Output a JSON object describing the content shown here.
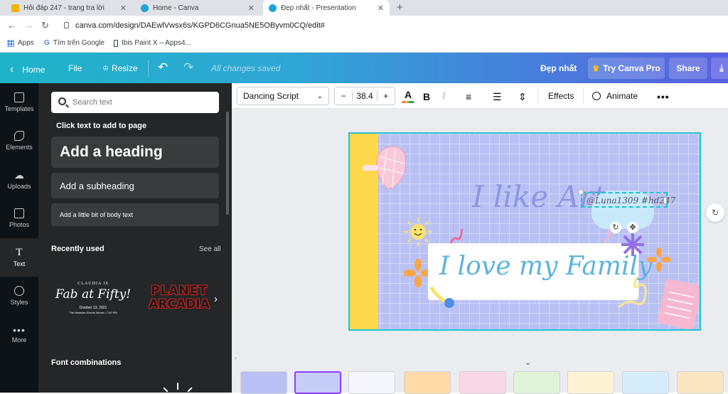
{
  "browser": {
    "tabs": [
      {
        "title": "Hỏi đáp 247 - trang tra lời",
        "active": false
      },
      {
        "title": "Home - Canva",
        "active": false
      },
      {
        "title": "Đẹp nhất - Presentation",
        "active": true
      }
    ],
    "url": "canva.com/design/DAEwlVwsx6s/KGPD6CGnua5NE5OByvm0CQ/edit#",
    "bookmarks": [
      "Apps",
      "Tìm trên Google",
      "Ibis Paint X – Apps4..."
    ]
  },
  "header": {
    "home": "Home",
    "file": "File",
    "resize": "Resize",
    "save_status": "All changes saved",
    "doc_title": "Đẹp nhất",
    "try_pro": "Try Canva Pro",
    "share": "Share"
  },
  "rail": [
    {
      "label": "Templates",
      "icon": "templates-icon"
    },
    {
      "label": "Elements",
      "icon": "elements-icon"
    },
    {
      "label": "Uploads",
      "icon": "uploads-icon"
    },
    {
      "label": "Photos",
      "icon": "photos-icon"
    },
    {
      "label": "Text",
      "icon": "text-icon",
      "active": true
    },
    {
      "label": "Styles",
      "icon": "styles-icon"
    },
    {
      "label": "More",
      "icon": "more-icon"
    }
  ],
  "panel": {
    "search_placeholder": "Search text",
    "click_hint": "Click text to add to page",
    "heading": "Add a heading",
    "subheading": "Add a subheading",
    "body": "Add a little bit of body text",
    "recently_used": "Recently used",
    "see_all": "See all",
    "recent1": {
      "small": "CLAUDIA IS",
      "big": "Fab at Fifty!",
      "line1": "October 13, 2021",
      "line2": "The Mansion Events Venue • 7:00 PM"
    },
    "recent2": {
      "line1": "PLANET",
      "line2": "ARCADIA"
    },
    "font_combinations": "Font combinations"
  },
  "toolbar": {
    "font": "Dancing Script",
    "font_size": "38.4",
    "effects": "Effects",
    "animate": "Animate"
  },
  "slide": {
    "title": "I like Art",
    "handle": "@Luna1309 #hd247",
    "family": "I love my Family"
  },
  "colors": {
    "accent": "#20c4cf",
    "header_start": "#1fb3c8",
    "header_end": "#5a5fe0",
    "slide_bg": "#b9c1f4",
    "text_purple": "#8f96e0",
    "family_text": "#5ab3df"
  }
}
